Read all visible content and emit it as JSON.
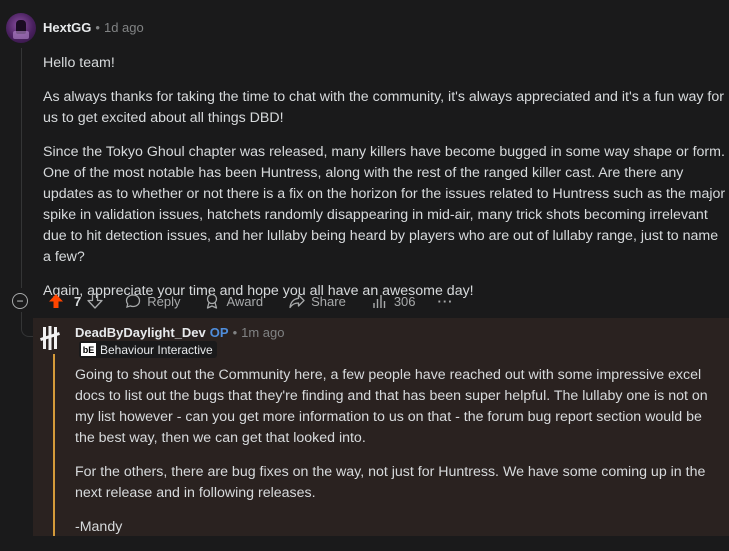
{
  "comment": {
    "author": "HextGG",
    "separator": "•",
    "time": "1d ago",
    "paragraphs": [
      "Hello team!",
      "As always thanks for taking the time to chat with the community, it's always appreciated and it's a fun way for us to get excited about all things DBD!",
      "Since the Tokyo Ghoul chapter was released, many killers have become bugged in some way shape or form. One of the most notable has been Huntress, along with the rest of the ranged killer cast. Are there any updates as to whether or not there is a fix on the horizon for the issues related to Huntress such as the major spike in validation issues, hatchets randomly disappearing in mid-air, many trick shots becoming irrelevant due to hit detection issues, and her lullaby being heard by players who are out of lullaby range, just to name a few?",
      "Again, appreciate your time and hope you all have an awesome day!"
    ],
    "actions": {
      "collapse": "−",
      "upvotes": "7",
      "reply": "Reply",
      "award": "Award",
      "share": "Share",
      "views": "306",
      "more": "···"
    }
  },
  "reply": {
    "author": "DeadByDaylight_Dev",
    "op_badge": "OP",
    "separator": "•",
    "time": "1m ago",
    "flair_logo": "bE",
    "flair": "Behaviour Interactive",
    "paragraphs": [
      "Going to shout out the Community here, a few people have reached out with some impressive excel docs to list out the bugs that they're finding and that has been super helpful. The lullaby one is not on my list however - can you get more information to us on that - the forum bug report section would be the best way, then we can get that looked into.",
      "For the others, there are bug fixes on the way, not just for Huntress. We have some coming up in the next release and in following releases.",
      "-Mandy"
    ]
  },
  "colors": {
    "background": "#1a1a1b",
    "upvote_active": "#ff4500",
    "op_blue": "#4f8ddb",
    "highlight_bar": "#d49a3a",
    "highlight_bg": "#2a2220"
  }
}
